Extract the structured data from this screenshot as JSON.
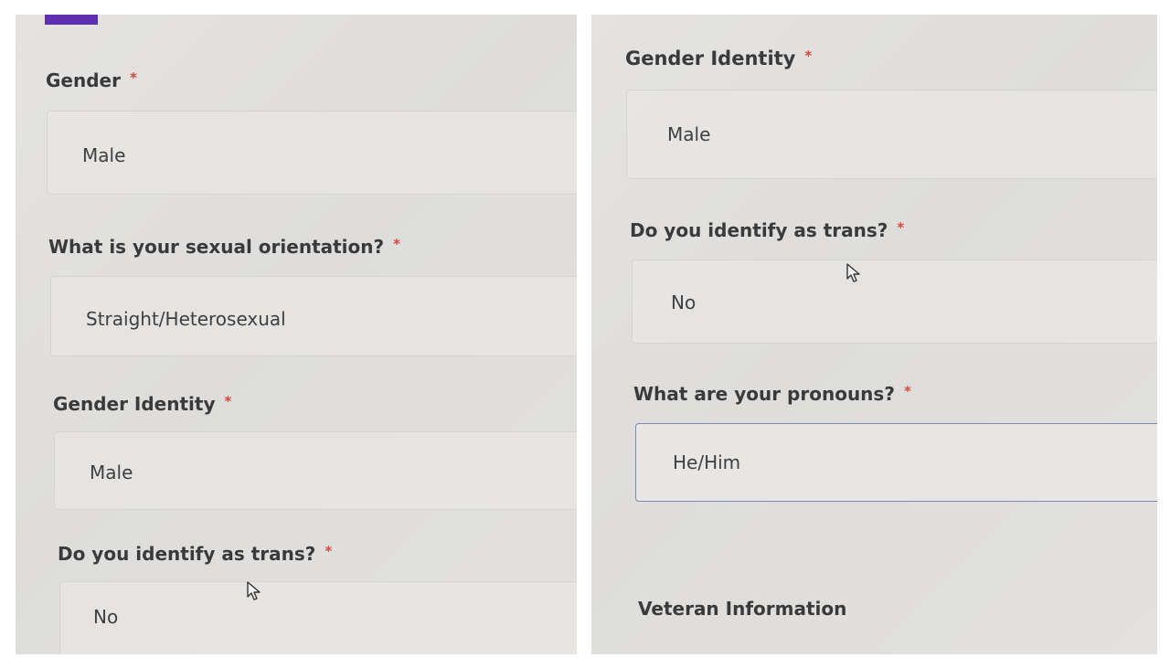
{
  "left_panel": {
    "gender": {
      "label": "Gender",
      "required_mark": "*",
      "value": "Male"
    },
    "orientation": {
      "label": "What is your sexual orientation?",
      "required_mark": "*",
      "value": "Straight/Heterosexual"
    },
    "gender_identity": {
      "label": "Gender Identity",
      "required_mark": "*",
      "value": "Male"
    },
    "trans": {
      "label": "Do you identify as trans?",
      "required_mark": "*",
      "value": "No"
    }
  },
  "right_panel": {
    "gender_identity": {
      "label": "Gender Identity",
      "required_mark": "*",
      "value": "Male"
    },
    "trans": {
      "label": "Do you identify as trans?",
      "required_mark": "*",
      "value": "No"
    },
    "pronouns": {
      "label": "What are your pronouns?",
      "required_mark": "*",
      "value": "He/Him"
    },
    "veteran_section": "Veteran Information"
  },
  "icons": {
    "cursor": "mouse-pointer-icon"
  },
  "colors": {
    "accent": "#5f2fb0",
    "required": "#d8463c",
    "focus_border": "#7b8ab4"
  }
}
